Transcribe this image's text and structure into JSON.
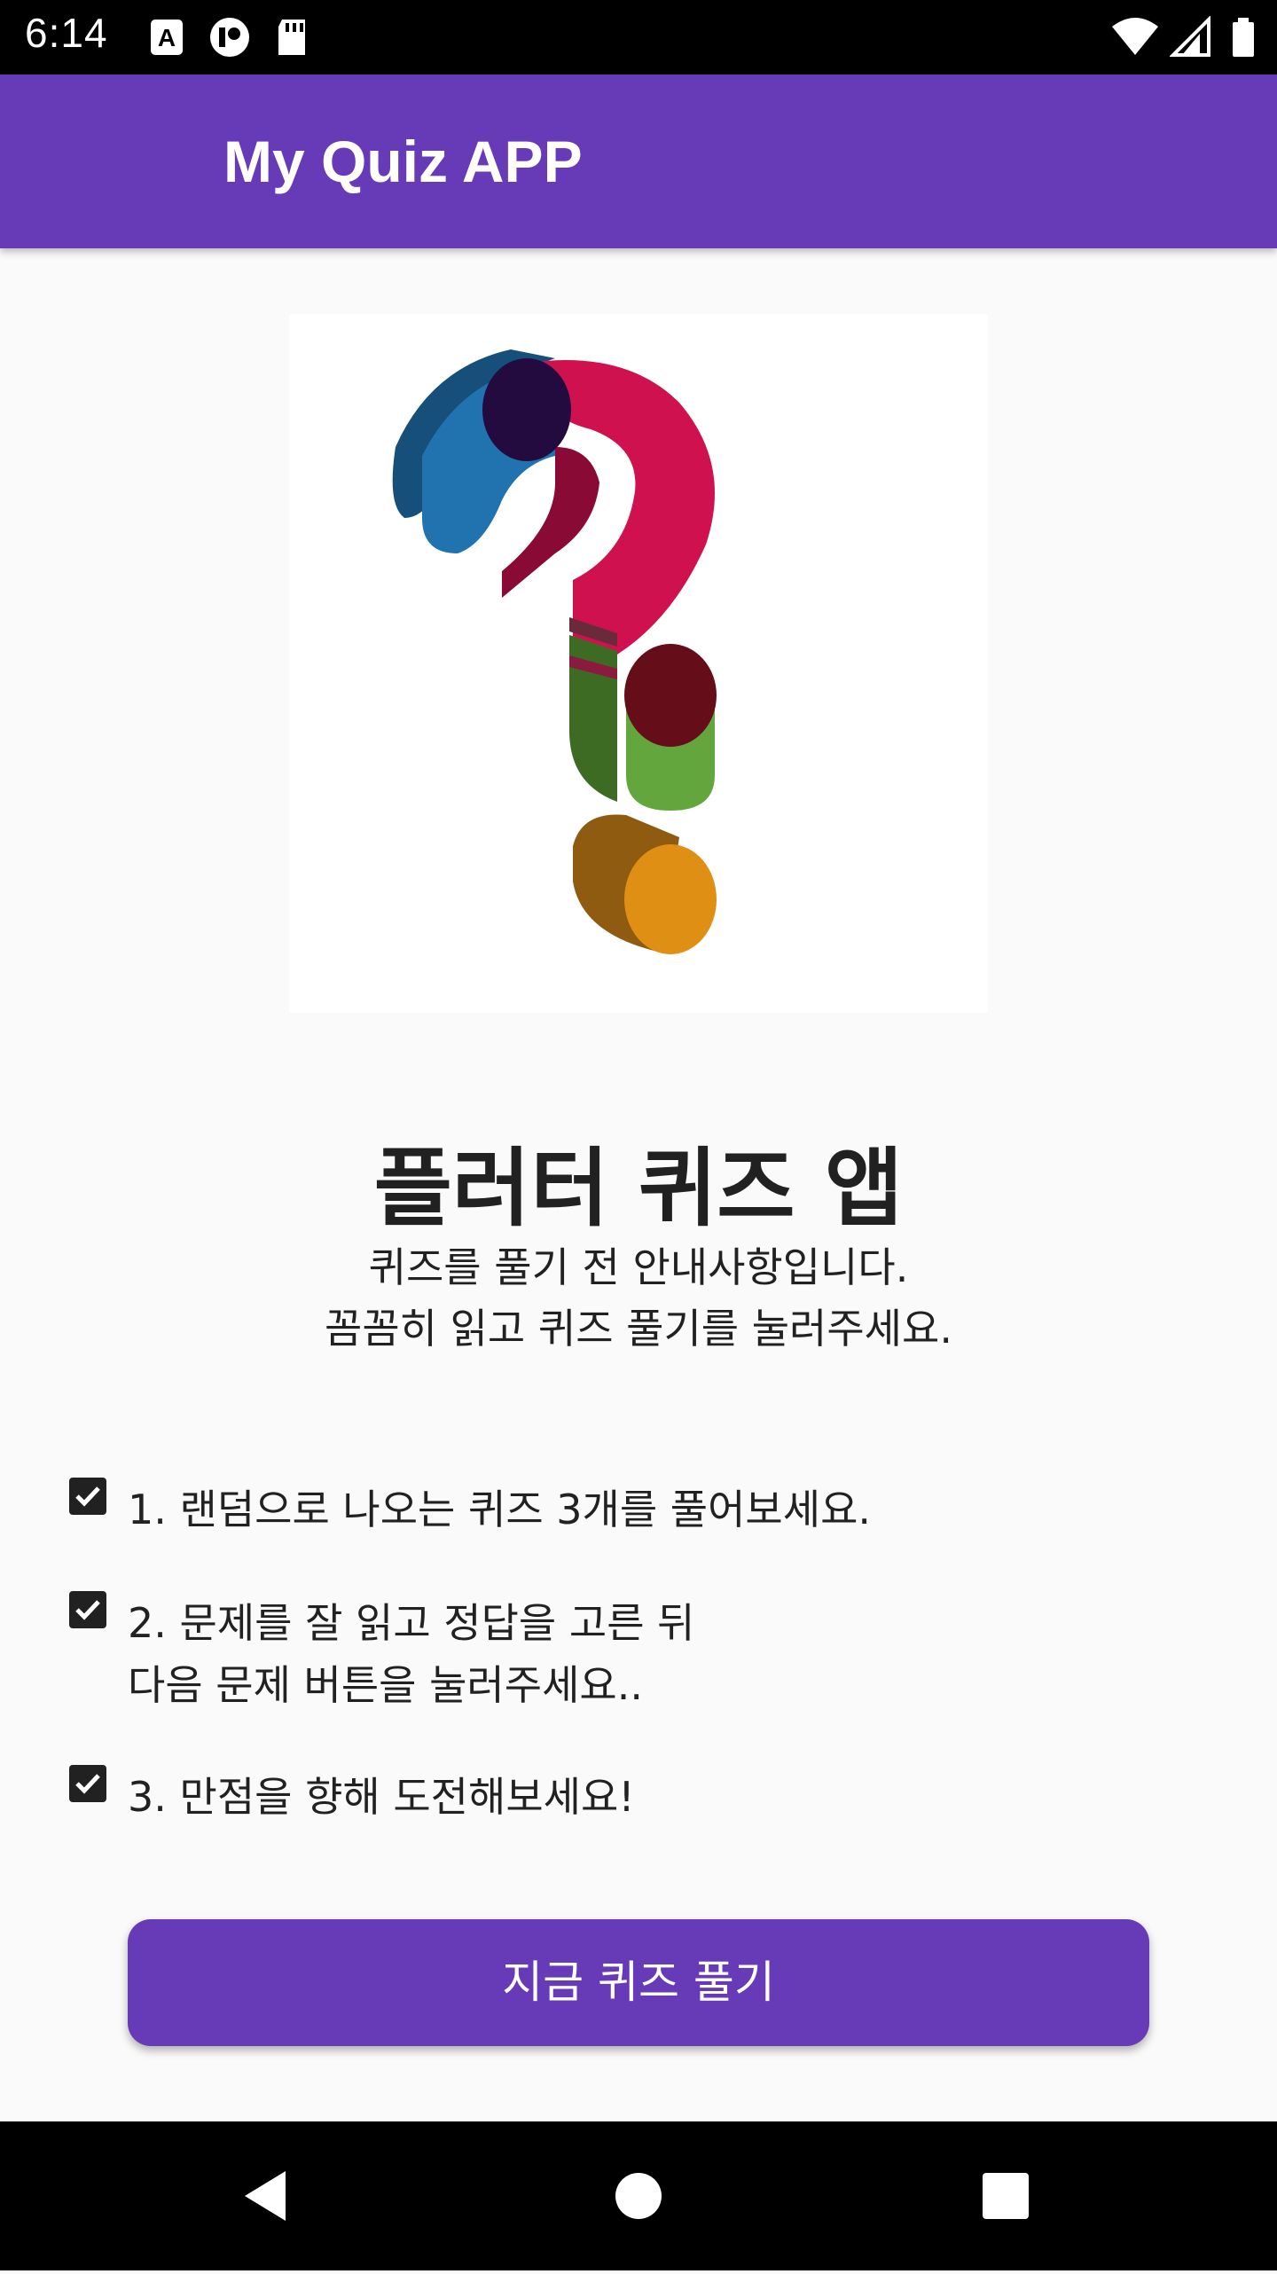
{
  "status_bar": {
    "time": "6:14",
    "left_icons": [
      "a-accessibility-icon",
      "circle-notification-icon",
      "sd-card-icon"
    ],
    "right_icons": [
      "wifi-icon",
      "signal-icon",
      "battery-icon"
    ]
  },
  "app_bar": {
    "title": "My Quiz APP",
    "color": "#673ab7"
  },
  "hero": {
    "icon": "question-mark-3d-icon"
  },
  "intro": {
    "title": "플러터 퀴즈 앱",
    "subtitle_line1": "퀴즈를 풀기 전 안내사항입니다.",
    "subtitle_line2": "꼼꼼히 읽고 퀴즈 풀기를 눌러주세요."
  },
  "rules": [
    {
      "line1": "1. 랜덤으로 나오는 퀴즈 3개를 풀어보세요.",
      "line2": "",
      "checked": true
    },
    {
      "line1": "2. 문제를 잘 읽고 정답을 고른 뒤",
      "line2": "다음 문제 버튼을 눌러주세요..",
      "checked": true
    },
    {
      "line1": "3. 만점을 향해 도전해보세요!",
      "line2": "",
      "checked": true
    }
  ],
  "start_button": {
    "label": "지금 퀴즈 풀기"
  },
  "nav": {
    "icons": [
      "back-icon",
      "home-icon",
      "recents-icon"
    ]
  }
}
